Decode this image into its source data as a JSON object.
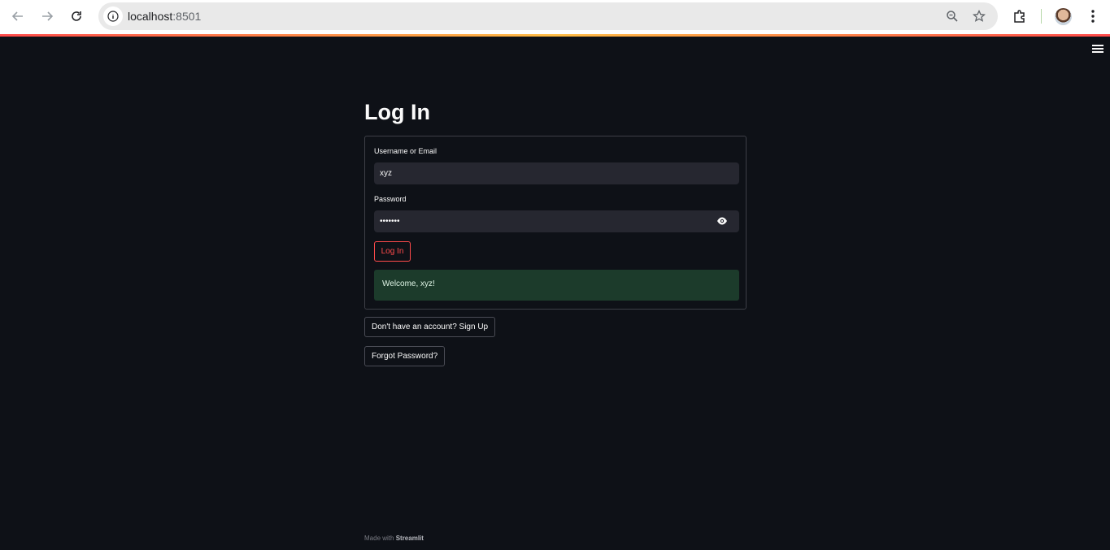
{
  "browser": {
    "url_host": "localhost",
    "url_port": ":8501"
  },
  "page": {
    "title": "Log In",
    "username_label": "Username or Email",
    "username_value": "xyz",
    "password_label": "Password",
    "password_value": "•••••••",
    "login_button": "Log In",
    "success_message": "Welcome, xyz!",
    "signup_button": "Don't have an account? Sign Up",
    "forgot_button": "Forgot Password?"
  },
  "footer": {
    "prefix": "Made with ",
    "brand": "Streamlit"
  },
  "colors": {
    "background": "#0e1117",
    "input_bg": "#262730",
    "primary": "#ff4b4b",
    "success_bg": "#1c3b2b"
  }
}
